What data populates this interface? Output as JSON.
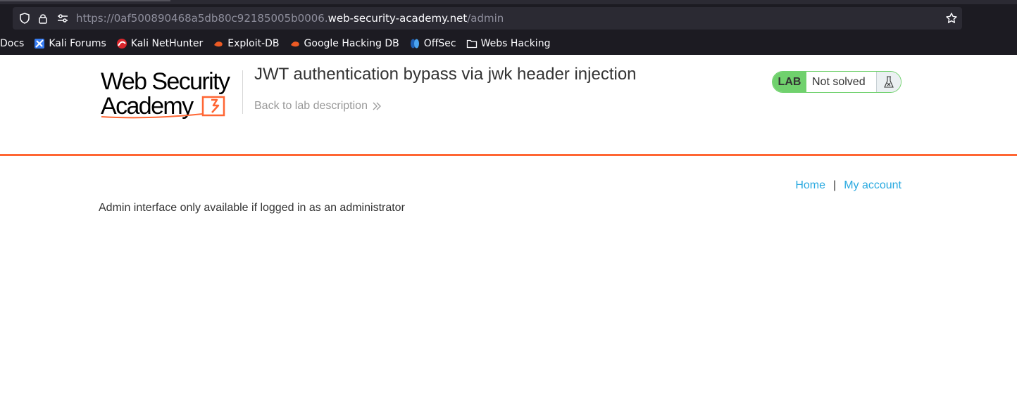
{
  "browser": {
    "url_prefix": "https://0af500890468a5db80c92185005b0006.",
    "url_host": "web-security-academy.net",
    "url_path": "/admin",
    "bookmarks": [
      {
        "label": "Docs",
        "icon": "none"
      },
      {
        "label": "Kali Forums",
        "icon": "kali-forums-icon"
      },
      {
        "label": "Kali NetHunter",
        "icon": "kali-nethunter-icon"
      },
      {
        "label": "Exploit-DB",
        "icon": "exploit-db-icon"
      },
      {
        "label": "Google Hacking DB",
        "icon": "ghdb-icon"
      },
      {
        "label": "OffSec",
        "icon": "offsec-icon"
      },
      {
        "label": "Webs Hacking",
        "icon": "folder-icon"
      }
    ]
  },
  "header": {
    "logo_line1": "Web Security",
    "logo_line2": "Academy",
    "lab_title": "JWT authentication bypass via jwk header injection",
    "back_link": "Back to lab description"
  },
  "lab_badge": {
    "tag": "LAB",
    "status": "Not solved",
    "colors": {
      "tag_bg": "#70d16d",
      "flask_bg": "#ebf0f2"
    }
  },
  "nav": {
    "home": "Home",
    "separator": "|",
    "my_account": "My account"
  },
  "main": {
    "message": "Admin interface only available if logged in as an administrator"
  },
  "colors": {
    "accent": "#ff6633",
    "link": "#29a9e0"
  }
}
